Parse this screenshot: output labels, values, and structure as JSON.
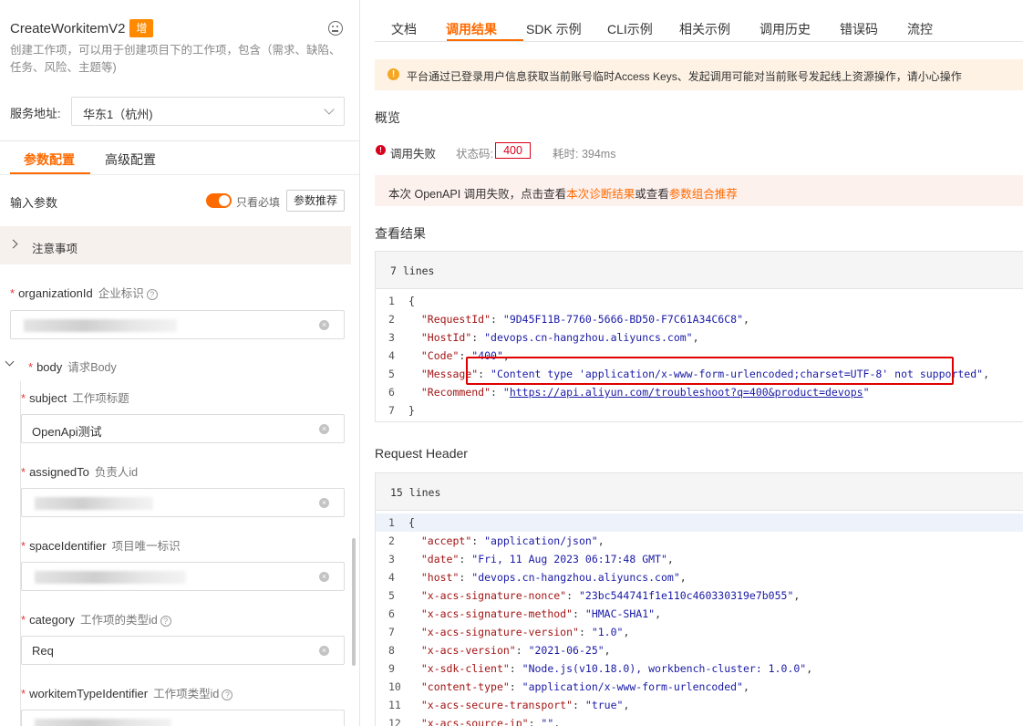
{
  "left": {
    "api_name": "CreateWorkitemV2",
    "badge": "增",
    "description": "创建工作项，可以用于创建项目下的工作项，包含（需求、缺陷、任务、风险、主题等)",
    "service": {
      "label": "服务地址:",
      "value": "华东1（杭州)"
    },
    "tabs": [
      {
        "label": "参数配置"
      },
      {
        "label": "高级配置"
      }
    ],
    "input_params_label": "输入参数",
    "required_only_label": "只看必填",
    "recommend_button": "参数推荐",
    "notice_label": "注意事项",
    "fields": {
      "organizationId": {
        "name": "organizationId",
        "cn": "企业标识"
      },
      "body": {
        "name": "body",
        "cn": "请求Body"
      },
      "subject": {
        "name": "subject",
        "cn": "工作项标题",
        "value": "OpenApi测试"
      },
      "assignedTo": {
        "name": "assignedTo",
        "cn": "负责人id"
      },
      "spaceIdentifier": {
        "name": "spaceIdentifier",
        "cn": "项目唯一标识"
      },
      "category": {
        "name": "category",
        "cn": "工作项的类型id",
        "value": "Req"
      },
      "workitemTypeIdentifier": {
        "name": "workitemTypeIdentifier",
        "cn": "工作项类型id"
      }
    }
  },
  "right": {
    "tabs": [
      {
        "label": "文档"
      },
      {
        "label": "调用结果"
      },
      {
        "label": "SDK 示例"
      },
      {
        "label": "CLI示例"
      },
      {
        "label": "相关示例"
      },
      {
        "label": "调用历史"
      },
      {
        "label": "错误码"
      },
      {
        "label": "流控"
      }
    ],
    "warning": "平台通过已登录用户信息获取当前账号临时Access Keys、发起调用可能对当前账号发起线上资源操作，请小心操作",
    "overview_title": "概览",
    "status": {
      "result": "调用失败",
      "code_label": "状态码:",
      "code": "400",
      "time": "耗时: 394ms"
    },
    "diagnosis": {
      "prefix": "本次 OpenAPI 调用失败，点击查看",
      "link1": "本次诊断结果",
      "mid": "或查看",
      "link2": "参数组合推荐"
    },
    "result_title": "查看结果",
    "result_lines_label": "7 lines",
    "result_lines": [
      "{",
      "  \"RequestId\": \"9D45F11B-7760-5666-BD50-F7C61A34C6C8\",",
      "  \"HostId\": \"devops.cn-hangzhou.aliyuncs.com\",",
      "  \"Code\": \"400\",",
      "  \"Message\": \"Content type 'application/x-www-form-urlencoded;charset=UTF-8' not supported\",",
      "  \"Recommend\": \"https://api.aliyun.com/troubleshoot?q=400&product=devops\"",
      "}"
    ],
    "header_title": "Request Header",
    "header_lines_label": "15 lines",
    "header_lines": [
      "{",
      "  \"accept\": \"application/json\",",
      "  \"date\": \"Fri, 11 Aug 2023 06:17:48 GMT\",",
      "  \"host\": \"devops.cn-hangzhou.aliyuncs.com\",",
      "  \"x-acs-signature-nonce\": \"23bc544741f1e110c460330319e7b055\",",
      "  \"x-acs-signature-method\": \"HMAC-SHA1\",",
      "  \"x-acs-signature-version\": \"1.0\",",
      "  \"x-acs-version\": \"2021-06-25\",",
      "  \"x-sdk-client\": \"Node.js(v10.18.0), workbench-cluster: 1.0.0\",",
      "  \"content-type\": \"application/x-www-form-urlencoded\",",
      "  \"x-acs-secure-transport\": \"true\",",
      "  \"x-acs-source-ip\": \"\","
    ]
  },
  "colors": {
    "accent": "#ff6a00",
    "error": "#d9001b",
    "warning": "#f5a623"
  }
}
